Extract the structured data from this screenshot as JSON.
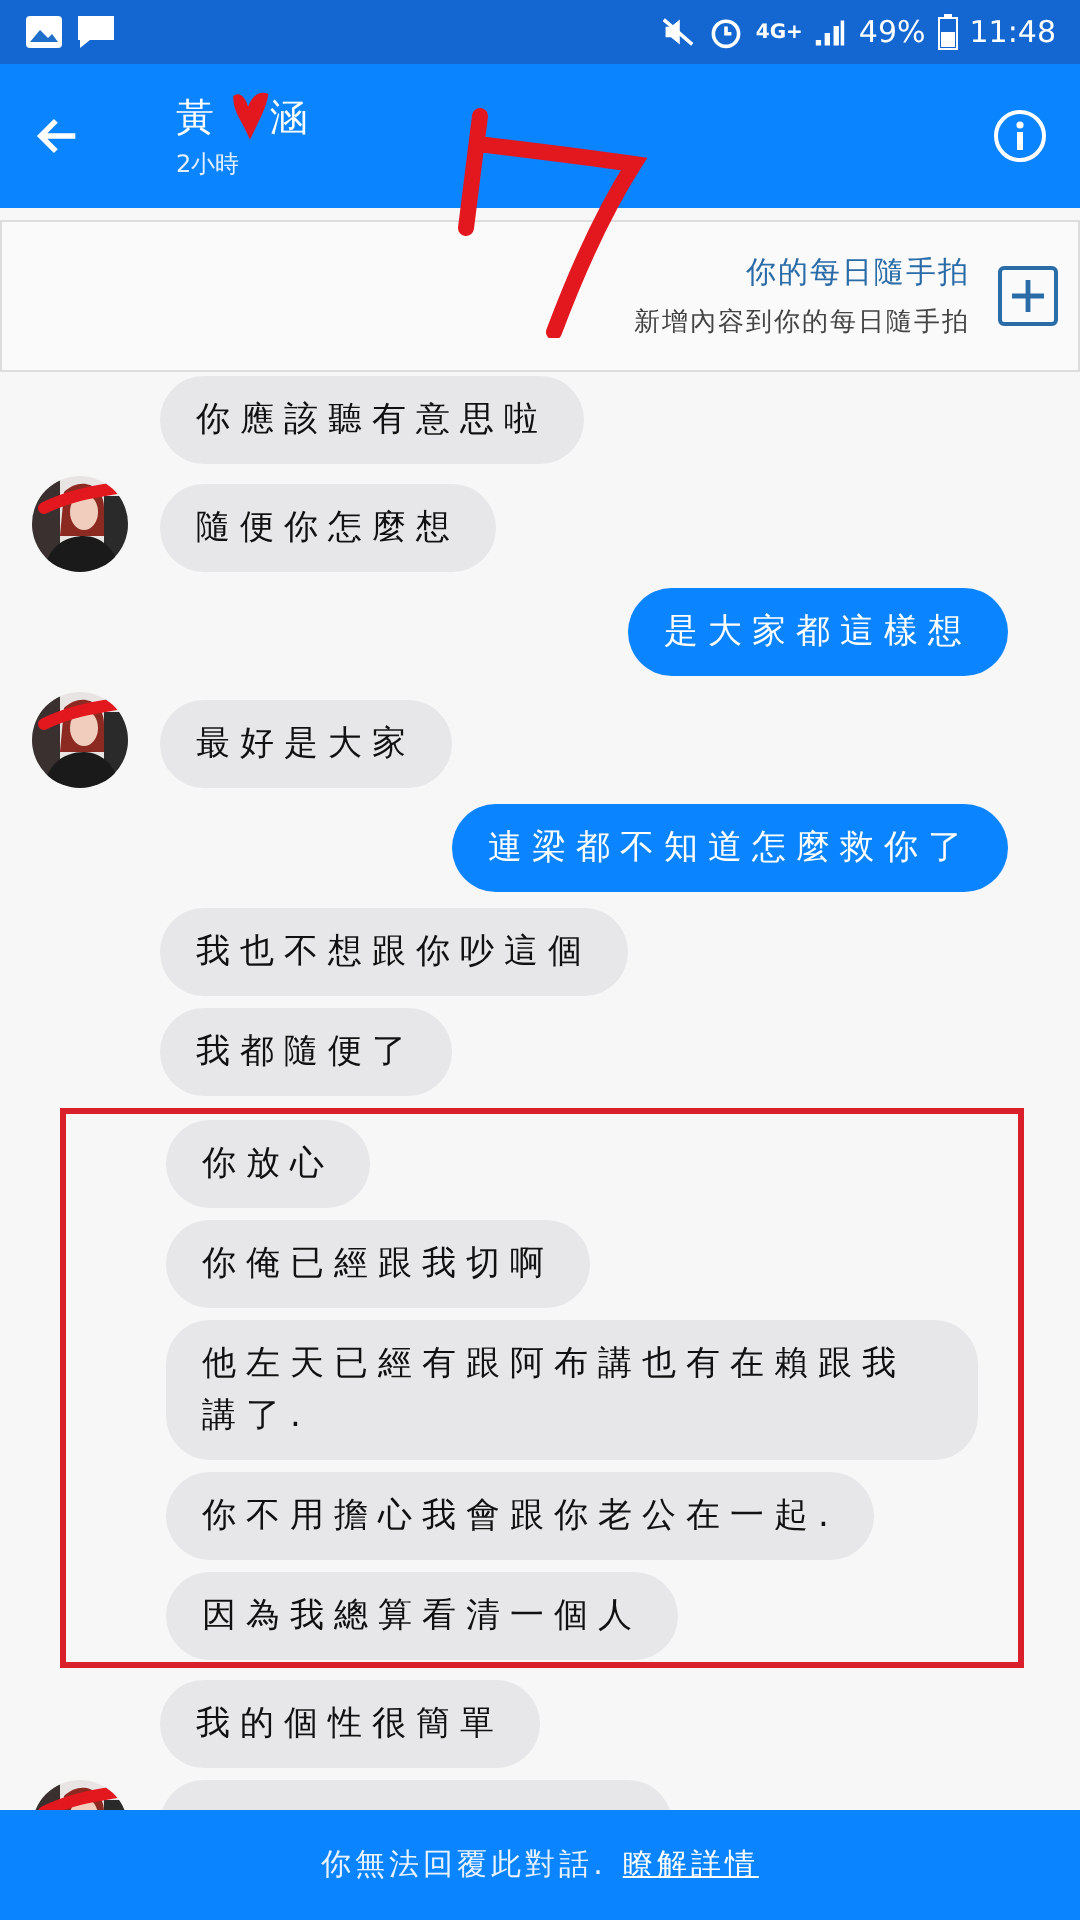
{
  "status_bar": {
    "network": "4G+",
    "battery": "49%",
    "time": "11:48"
  },
  "header": {
    "name_parts": [
      "黃",
      "涵"
    ],
    "subtitle": "2小時"
  },
  "story_card": {
    "title": "你的每日隨手拍",
    "subtitle": "新增內容到你的每日隨手拍"
  },
  "messages": [
    {
      "kind": "received",
      "avatar": false,
      "boxed": false,
      "text": "你應該聽有意思啦"
    },
    {
      "kind": "received",
      "avatar": true,
      "boxed": false,
      "text": "隨便你怎麼想"
    },
    {
      "kind": "sent",
      "boxed": false,
      "text": "是大家都這樣想"
    },
    {
      "kind": "received",
      "avatar": true,
      "boxed": false,
      "text": "最好是大家"
    },
    {
      "kind": "sent",
      "boxed": false,
      "text": "連梁都不知道怎麼救你了"
    },
    {
      "kind": "received",
      "avatar": false,
      "boxed": false,
      "text": "我也不想跟你吵這個"
    },
    {
      "kind": "received",
      "avatar": false,
      "boxed": false,
      "text": "我都隨便了"
    },
    {
      "kind": "received",
      "avatar": false,
      "boxed": true,
      "text": "你放心"
    },
    {
      "kind": "received",
      "avatar": false,
      "boxed": true,
      "text": "你俺已經跟我切啊"
    },
    {
      "kind": "received",
      "avatar": false,
      "boxed": true,
      "text": "他左天已經有跟阿布講也有在賴跟我講了."
    },
    {
      "kind": "received",
      "avatar": false,
      "boxed": true,
      "text": "你不用擔心我會跟你老公在一起."
    },
    {
      "kind": "received",
      "avatar": false,
      "boxed": true,
      "text": "因為我總算看清一個人"
    },
    {
      "kind": "received",
      "avatar": false,
      "boxed": false,
      "text": "我的個性很簡單"
    },
    {
      "kind": "cut_off",
      "avatar": true,
      "boxed": false
    }
  ],
  "footer": {
    "notice": "你無法回覆此對話.",
    "link": "瞭解詳情"
  }
}
